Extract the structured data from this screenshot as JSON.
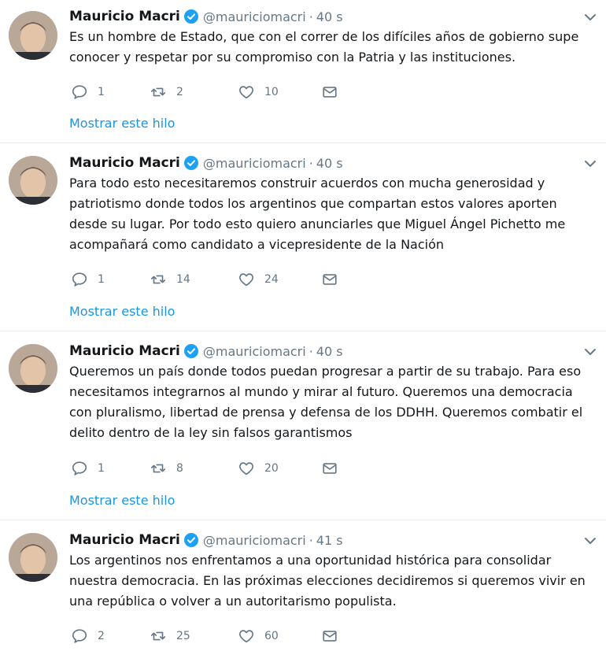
{
  "tweets": [
    {
      "name": "Mauricio Macri",
      "handle": "@mauriciomacri",
      "sep": "·",
      "time": "40 s",
      "text": "Es un hombre de Estado, que con el correr de los difíciles años de gobierno supe conocer y respetar por su compromiso con la Patria y las instituciones.",
      "replies": "1",
      "retweets": "2",
      "likes": "10",
      "thread": "Mostrar este hilo"
    },
    {
      "name": "Mauricio Macri",
      "handle": "@mauriciomacri",
      "sep": "·",
      "time": "40 s",
      "text": "Para todo esto necesitaremos construir acuerdos con mucha generosidad y patriotismo donde todos los argentinos que compartan estos valores aporten desde su lugar. Por todo esto quiero anunciarles que Miguel Ángel Pichetto me acompañará como candidato a vicepresidente de la Nación",
      "replies": "1",
      "retweets": "14",
      "likes": "24",
      "thread": "Mostrar este hilo"
    },
    {
      "name": "Mauricio Macri",
      "handle": "@mauriciomacri",
      "sep": "·",
      "time": "40 s",
      "text": "Queremos un país donde todos puedan progresar a partir de su trabajo. Para eso necesitamos integrarnos al mundo y mirar al futuro. Queremos una democracia con pluralismo, libertad de prensa y defensa de los DDHH. Queremos combatir el delito dentro de la ley sin falsos garantismos",
      "replies": "1",
      "retweets": "8",
      "likes": "20",
      "thread": "Mostrar este hilo"
    },
    {
      "name": "Mauricio Macri",
      "handle": "@mauriciomacri",
      "sep": "·",
      "time": "41 s",
      "text": "Los argentinos nos enfrentamos a una oportunidad histórica para consolidar nuestra democracia. En las próximas elecciones decidiremos si queremos vivir en una república o volver a un autoritarismo populista.",
      "replies": "2",
      "retweets": "25",
      "likes": "60"
    }
  ],
  "icons": {
    "verified": "verified-badge-icon",
    "caret": "chevron-down-icon",
    "reply": "reply-icon",
    "retweet": "retweet-icon",
    "like": "heart-icon",
    "dm": "envelope-icon"
  },
  "colors": {
    "link": "#1b95e0",
    "verified": "#1da1f2",
    "muted": "#657786",
    "divider": "#e6ecf0"
  }
}
